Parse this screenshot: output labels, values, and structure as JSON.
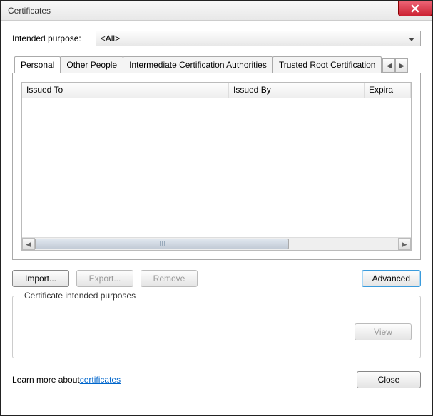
{
  "window": {
    "title": "Certificates"
  },
  "purpose": {
    "label": "Intended purpose:",
    "value": "<All>"
  },
  "tabs": [
    {
      "label": "Personal",
      "active": true
    },
    {
      "label": "Other People",
      "active": false
    },
    {
      "label": "Intermediate Certification Authorities",
      "active": false
    },
    {
      "label": "Trusted Root Certification",
      "active": false
    }
  ],
  "columns": {
    "c1": "Issued To",
    "c2": "Issued By",
    "c3": "Expira"
  },
  "rows": [],
  "buttons": {
    "import": "Import...",
    "export": "Export...",
    "remove": "Remove",
    "advanced": "Advanced",
    "view": "View",
    "close": "Close"
  },
  "group": {
    "title": "Certificate intended purposes"
  },
  "footer": {
    "text": "Learn more about ",
    "link": "certificates"
  }
}
